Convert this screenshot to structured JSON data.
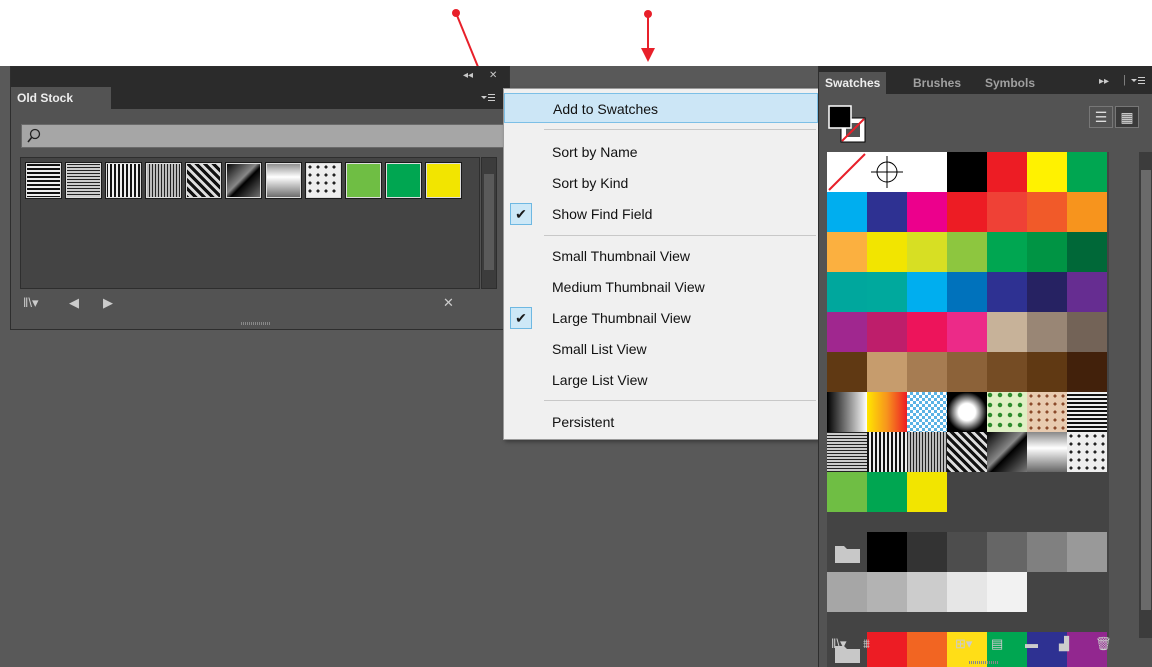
{
  "floating_panel": {
    "tab_label": "Old Stock",
    "collapse_icon": "double-chevron-left-icon",
    "close_icon": "close-icon",
    "search_icon": "search-icon",
    "swatches": [
      {
        "kind": "pattern",
        "pattern": "horizontal-lines"
      },
      {
        "kind": "pattern",
        "pattern": "horizontal-lines-fine"
      },
      {
        "kind": "pattern",
        "pattern": "vertical-lines"
      },
      {
        "kind": "pattern",
        "pattern": "vertical-lines-fine"
      },
      {
        "kind": "pattern",
        "pattern": "diagonal-stripes"
      },
      {
        "kind": "pattern",
        "pattern": "diagonal-gradient"
      },
      {
        "kind": "pattern",
        "pattern": "gray-gradient"
      },
      {
        "kind": "pattern",
        "pattern": "dots"
      },
      {
        "kind": "color",
        "color": "#6fbe44"
      },
      {
        "kind": "color",
        "color": "#00a651"
      },
      {
        "kind": "color",
        "color": "#f2e500"
      }
    ],
    "bottom_icons": [
      "library-menu-icon",
      "previous-arrow-icon",
      "next-arrow-icon",
      "delete-library-icon"
    ]
  },
  "flyout_menu": {
    "items": [
      {
        "label": "Add to Swatches",
        "highlighted": true,
        "checked": false
      },
      {
        "label": "Sort by Name",
        "checked": false
      },
      {
        "label": "Sort by Kind",
        "checked": false
      },
      {
        "label": "Show Find Field",
        "checked": true
      },
      {
        "label": "Small Thumbnail View",
        "checked": false
      },
      {
        "label": "Medium Thumbnail View",
        "checked": false
      },
      {
        "label": "Large Thumbnail View",
        "checked": true
      },
      {
        "label": "Small List View",
        "checked": false
      },
      {
        "label": "Large List View",
        "checked": false
      },
      {
        "label": "Persistent",
        "checked": false
      }
    ]
  },
  "swatches_panel": {
    "tabs": [
      "Swatches",
      "Brushes",
      "Symbols"
    ],
    "active_tab": "Swatches",
    "view_buttons": [
      "list-view-icon",
      "thumbnail-view-icon"
    ],
    "colors": {
      "row2": [
        "#00aeef",
        "#2e3192",
        "#ec008c",
        "#ed1c24",
        "#ef4136",
        "#f15a29",
        "#f7941d"
      ],
      "row3": [
        "#fbb040",
        "#f2e500",
        "#d7df23",
        "#8dc63f",
        "#00a651",
        "#009444",
        "#006838"
      ],
      "row4": [
        "#00a79d",
        "#00a99d",
        "#00aeef",
        "#0072bc",
        "#2e3192",
        "#262262",
        "#662d91"
      ],
      "row5": [
        "#a0278f",
        "#be1e6b",
        "#ed145b",
        "#ec2a88",
        "#c7b299",
        "#998675",
        "#736357"
      ],
      "row6": [
        "#603913",
        "#c69c6d",
        "#a67c52",
        "#8c6239",
        "#754c24",
        "#603913",
        "#42210b"
      ],
      "row9": [
        "#6fbe44",
        "#00a651",
        "#f2e500"
      ],
      "gray_row1": [
        "#000000",
        "#333333",
        "#4d4d4d",
        "#666666",
        "#808080",
        "#999999"
      ],
      "gray_row2": [
        "#a6a6a6",
        "#b3b3b3",
        "#cccccc",
        "#e6e6e6",
        "#f2f2f2"
      ],
      "last_row": [
        "#ed1c24",
        "#f26522",
        "#ffde17",
        "#00a651",
        "#2e3192",
        "#92278f"
      ]
    },
    "bottom_icons": [
      "library-menu-icon",
      "show-kind-icon",
      "swatch-options-icon",
      "new-color-group-icon",
      "new-swatch-icon",
      "delete-swatch-icon"
    ]
  },
  "colors": {
    "arrow": "#e8202a",
    "panel_bg": "#535353",
    "menu_highlight": "#cce6f6"
  }
}
